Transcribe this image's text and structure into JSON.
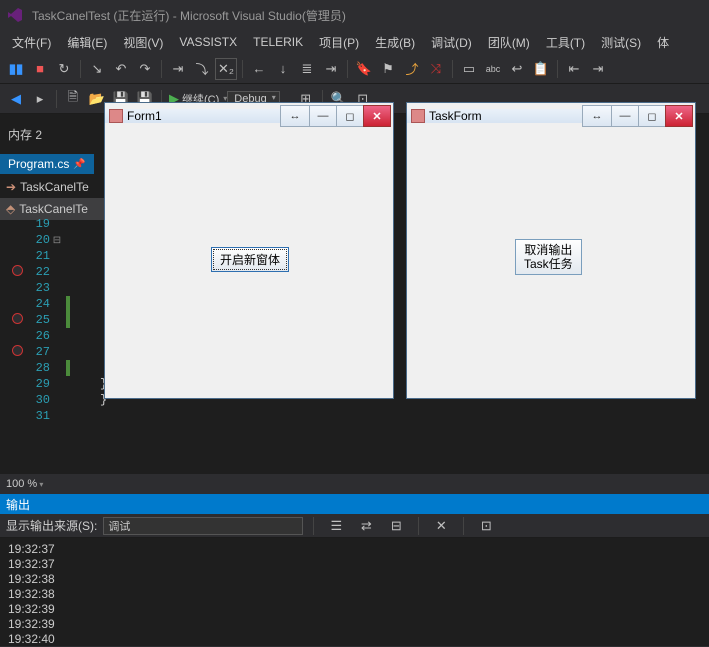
{
  "title": "TaskCanelTest (正在运行) - Microsoft Visual Studio(管理员)",
  "menu": [
    "文件(F)",
    "编辑(E)",
    "视图(V)",
    "VASSISTX",
    "TELERIK",
    "项目(P)",
    "生成(B)",
    "调试(D)",
    "团队(M)",
    "工具(T)",
    "测试(S)",
    "体"
  ],
  "toolbar2": {
    "continue": "继续(C)",
    "config": "Debug"
  },
  "memory_tab": "内存 2",
  "file_tab": "Program.cs",
  "nav": [
    {
      "icon": "arrow",
      "label": "TaskCanelTe"
    },
    {
      "icon": "va",
      "label": "TaskCanelTe"
    }
  ],
  "lines": [
    {
      "n": "19"
    },
    {
      "n": "20",
      "fold": "⊟"
    },
    {
      "n": "21"
    },
    {
      "n": "22",
      "bp": true
    },
    {
      "n": "23"
    },
    {
      "n": "24",
      "mark": true
    },
    {
      "n": "25",
      "bp": true,
      "mark": true
    },
    {
      "n": "26"
    },
    {
      "n": "27",
      "bp": true
    },
    {
      "n": "28",
      "mark": true
    },
    {
      "n": "29",
      "brace": "                    }"
    },
    {
      "n": "30",
      "brace": "                }"
    },
    {
      "n": "31"
    }
  ],
  "zoom": "100 %",
  "output": {
    "title": "输出",
    "src_label": "显示输出来源(S):",
    "src_value": "调试",
    "lines": [
      "19:32:37",
      "19:32:37",
      "19:32:38",
      "19:32:38",
      "19:32:39",
      "19:32:39",
      "19:32:40"
    ]
  },
  "form1": {
    "title": "Form1",
    "button": "开启新窗体"
  },
  "taskform": {
    "title": "TaskForm",
    "button_l1": "取消输出",
    "button_l2": "Task任务"
  }
}
